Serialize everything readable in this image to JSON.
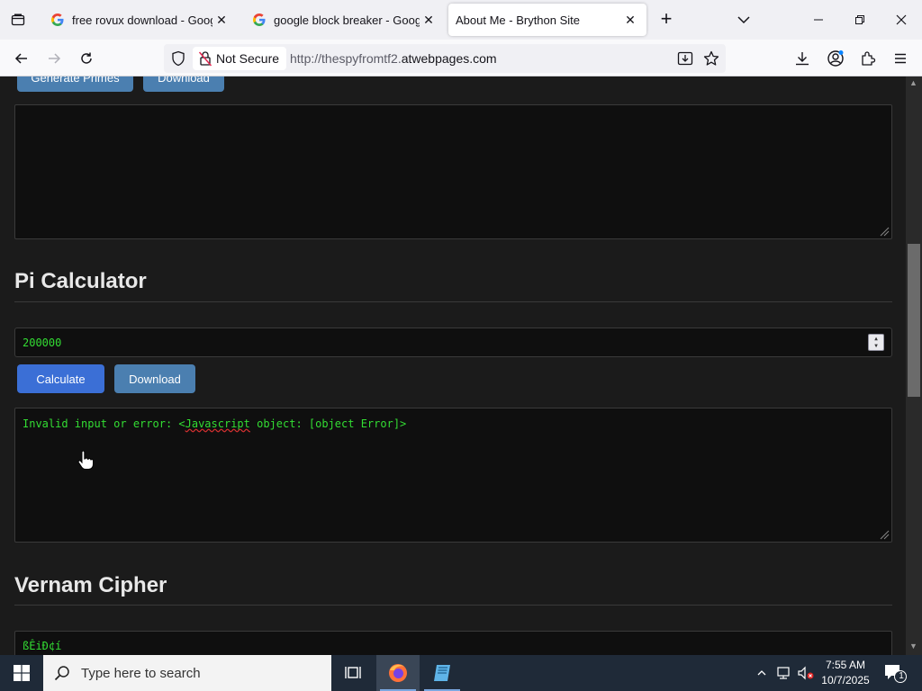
{
  "browser": {
    "tabs": [
      {
        "title": "free rovux download - Google S",
        "active": false
      },
      {
        "title": "google block breaker - Google",
        "active": false
      },
      {
        "title": "About Me - Brython Site",
        "active": true
      }
    ],
    "security_label": "Not Secure",
    "url_prefix": "http://thespyfromtf2.",
    "url_domain": "atwebpages.com"
  },
  "page": {
    "top_buttons": {
      "generate_label": "Generate Primes",
      "download_label": "Download"
    },
    "pi_calculator": {
      "heading": "Pi Calculator",
      "input_value": "200000",
      "calculate_label": "Calculate",
      "download_label": "Download",
      "output_prefix": "Invalid input or error: <",
      "output_misspelled": "Javascript",
      "output_suffix": " object: [object Error]>"
    },
    "vernam_cipher": {
      "heading": "Vernam Cipher",
      "output_value": "ßÊi\u0013\u0013Ð¢í"
    }
  },
  "taskbar": {
    "search_placeholder": "Type here to search",
    "time": "7:55 AM",
    "date": "10/7/2025",
    "notification_count": "1"
  },
  "colors": {
    "page_bg": "#1b1b1b",
    "terminal_green": "#33dd33",
    "calculate_button": "#3b6fd6",
    "download_button": "#4b7fb0"
  }
}
